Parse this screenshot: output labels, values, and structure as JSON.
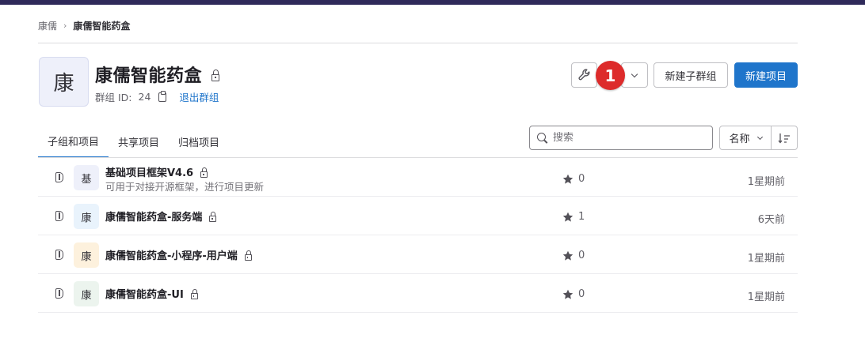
{
  "breadcrumb": {
    "root": "康儒",
    "current": "康儒智能药盒"
  },
  "group": {
    "avatar_letter": "康",
    "name": "康儒智能药盒",
    "id_label": "群组 ID:",
    "id_value": "24",
    "leave_label": "退出群组"
  },
  "actions": {
    "badge": "1",
    "new_subgroup": "新建子群组",
    "new_project": "新建项目"
  },
  "tabs": [
    {
      "label": "子组和项目",
      "active": true
    },
    {
      "label": "共享项目",
      "active": false
    },
    {
      "label": "归档项目",
      "active": false
    }
  ],
  "search": {
    "placeholder": "搜索",
    "value": ""
  },
  "sort": {
    "label": "名称"
  },
  "projects": [
    {
      "avatar": "基",
      "avatar_bg": "#eef0fa",
      "name": "基础项目框架V4.6",
      "description": "可用于对接开源框架，进行项目更新",
      "stars": "0",
      "updated": "1星期前"
    },
    {
      "avatar": "康",
      "avatar_bg": "#e9f3fc",
      "name": "康儒智能药盒-服务端",
      "description": "",
      "stars": "1",
      "updated": "6天前"
    },
    {
      "avatar": "康",
      "avatar_bg": "#fdf1dd",
      "name": "康儒智能药盒-小程序-用户端",
      "description": "",
      "stars": "0",
      "updated": "1星期前"
    },
    {
      "avatar": "康",
      "avatar_bg": "#ecf4ee",
      "name": "康儒智能药盒-UI",
      "description": "",
      "stars": "0",
      "updated": "1星期前"
    }
  ],
  "colors": {
    "accent": "#1f75cb",
    "badge": "#dd2b2b",
    "topbar": "#2f2a5a"
  }
}
